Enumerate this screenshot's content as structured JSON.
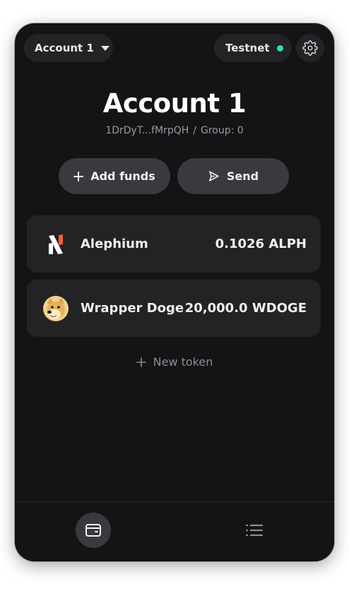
{
  "header": {
    "account_label": "Account 1",
    "network_label": "Testnet",
    "network_status_color": "#2ee0b5"
  },
  "account": {
    "name": "Account 1",
    "address": "1DrDyT...fMrpQH",
    "separator": "/",
    "group": "Group: 0"
  },
  "actions": {
    "add_funds": "Add funds",
    "send": "Send"
  },
  "tokens": [
    {
      "name": "Alephium",
      "amount": "0.1026 ALPH",
      "icon": "alephium-logo"
    },
    {
      "name": "Wrapper Doge",
      "amount": "20,000.0 WDOGE",
      "icon": "doge-logo"
    }
  ],
  "new_token_label": "New token",
  "nav": {
    "items": [
      {
        "icon": "wallet-icon",
        "active": true
      },
      {
        "icon": "list-icon",
        "active": false
      }
    ]
  },
  "colors": {
    "background": "#141416",
    "card": "#232326",
    "button": "#3a3a3e",
    "accent": "#2ee0b5"
  }
}
